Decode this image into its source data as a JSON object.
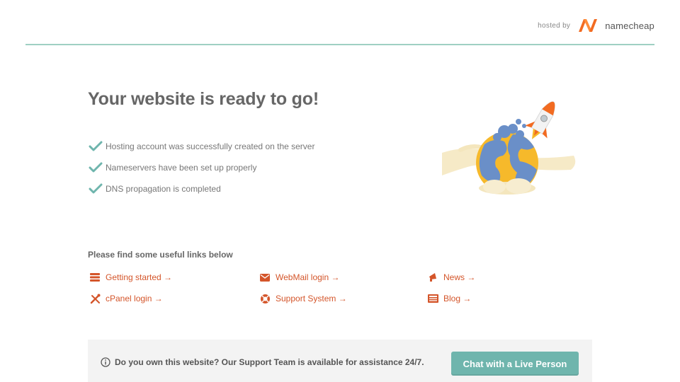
{
  "header": {
    "hosted_by": "hosted by",
    "brand_name": "namecheap",
    "brand_color": "#f26b21",
    "rule_color": "#9fd0c3"
  },
  "main": {
    "title": "Your website is ready to go!",
    "checks": [
      {
        "icon": "checkmark-icon",
        "text": "Hosting account was successfully created on the server"
      },
      {
        "icon": "checkmark-icon",
        "text": "Nameservers have been set up properly"
      },
      {
        "icon": "checkmark-icon",
        "text": "DNS propagation is completed"
      }
    ],
    "check_color": "#6fb5ad"
  },
  "links": {
    "heading": "Please find some useful links below",
    "link_color": "#d4552a",
    "items": [
      {
        "icon": "stack-icon",
        "label": "Getting started →"
      },
      {
        "icon": "envelope-icon",
        "label": "WebMail login →"
      },
      {
        "icon": "megaphone-icon",
        "label": "News →"
      },
      {
        "icon": "tools-icon",
        "label": "cPanel login →"
      },
      {
        "icon": "lifebuoy-icon",
        "label": "Support System →"
      },
      {
        "icon": "newspaper-icon",
        "label": "Blog →"
      }
    ]
  },
  "support": {
    "info_icon": "info-icon",
    "text": "Do you own this website? Our Support Team is available for assistance 24/7.",
    "chat_button": "Chat with a Live Person",
    "button_color": "#6fb5ad"
  }
}
